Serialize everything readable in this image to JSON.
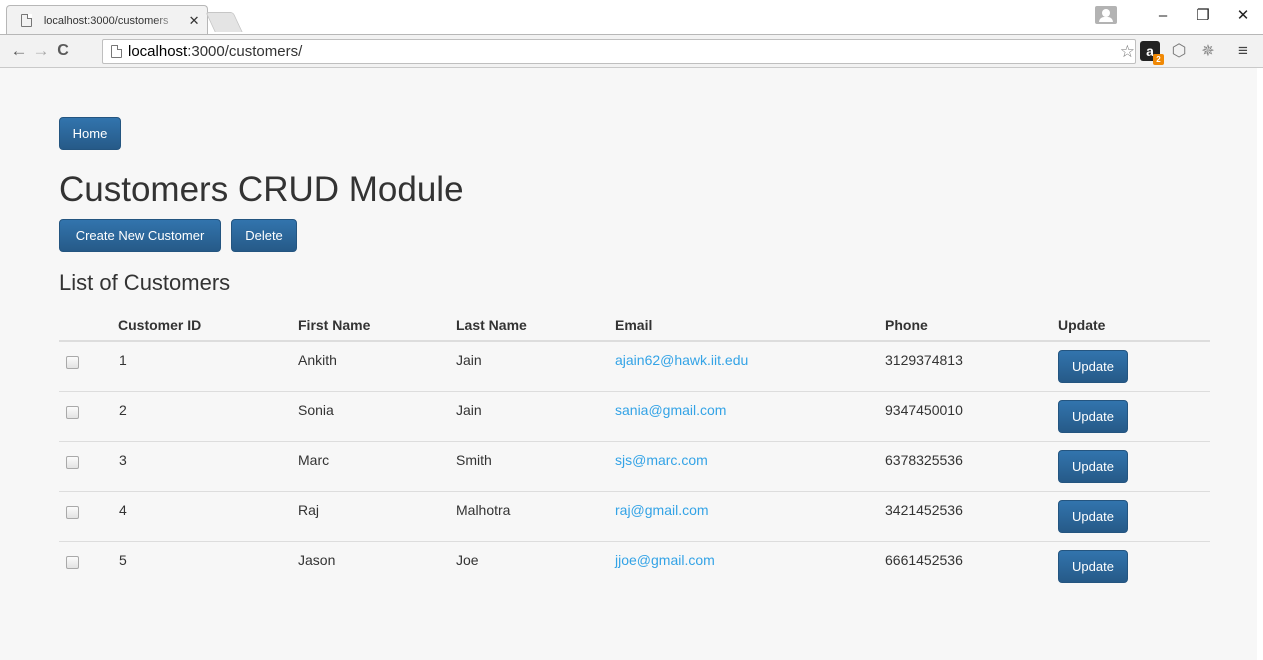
{
  "browser": {
    "tab_title": "localhost:3000/customers",
    "tab_close": "✕",
    "url_host": "localhost",
    "url_path": ":3000/customers/",
    "back_glyph": "←",
    "forward_glyph": "→",
    "reload_glyph": "C",
    "star_glyph": "☆",
    "menu_glyph": "≡",
    "amazon_glyph": "a",
    "amazon_badge": "2",
    "minimize_glyph": "–",
    "restore_glyph": "❐",
    "close_glyph": "✕",
    "icons": [
      "page-icon",
      "star-icon",
      "amazon-extension-icon",
      "cube-extension-icon",
      "tool-extension-icon",
      "menu-icon",
      "profile-icon"
    ]
  },
  "page": {
    "home_label": "Home",
    "title": "Customers CRUD Module",
    "create_label": "Create New Customer",
    "delete_label": "Delete",
    "list_title": "List of Customers"
  },
  "table": {
    "headers": {
      "id": "Customer ID",
      "first": "First Name",
      "last": "Last Name",
      "email": "Email",
      "phone": "Phone",
      "update": "Update"
    },
    "rows": [
      {
        "id": "1",
        "first": "Ankith",
        "last": "Jain",
        "email": "ajain62@hawk.iit.edu",
        "phone": "3129374813",
        "update": "Update"
      },
      {
        "id": "2",
        "first": "Sonia",
        "last": "Jain",
        "email": "sania@gmail.com",
        "phone": "9347450010",
        "update": "Update"
      },
      {
        "id": "3",
        "first": "Marc",
        "last": "Smith",
        "email": "sjs@marc.com",
        "phone": "6378325536",
        "update": "Update"
      },
      {
        "id": "4",
        "first": "Raj",
        "last": "Malhotra",
        "email": "raj@gmail.com",
        "phone": "3421452536",
        "update": "Update"
      },
      {
        "id": "5",
        "first": "Jason",
        "last": "Joe",
        "email": "jjoe@gmail.com",
        "phone": "6661452536",
        "update": "Update"
      }
    ]
  },
  "colors": {
    "primary_button": "#2a6496",
    "link": "#33a3e6",
    "page_background": "#f7f7f7"
  }
}
